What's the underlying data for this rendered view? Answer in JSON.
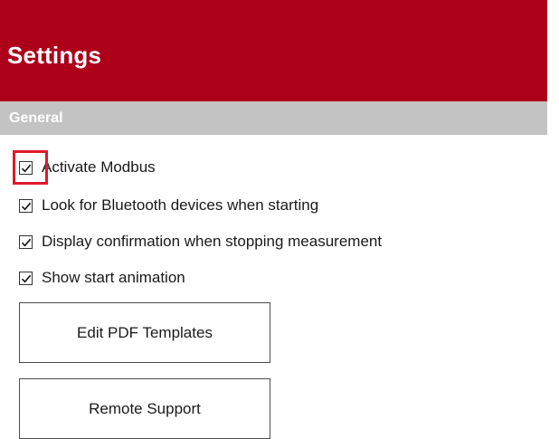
{
  "header": {
    "title": "Settings",
    "color": "#ad0019"
  },
  "section": {
    "title": "General"
  },
  "options": [
    {
      "label": "Activate Modbus",
      "checked": true
    },
    {
      "label": "Look for Bluetooth devices when starting",
      "checked": true
    },
    {
      "label": "Display confirmation when stopping measurement",
      "checked": true
    },
    {
      "label": "Show start animation",
      "checked": true
    }
  ],
  "buttons": {
    "edit_pdf": "Edit PDF Templates",
    "remote_support": "Remote Support"
  },
  "icons": {
    "check": "checkmark-icon"
  }
}
